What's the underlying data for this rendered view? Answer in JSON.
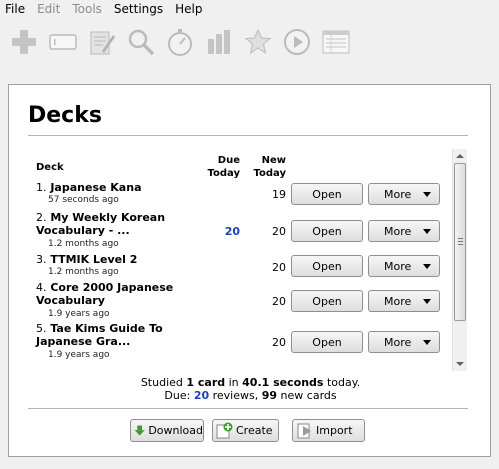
{
  "menu": {
    "file": "File",
    "edit": "Edit",
    "tools": "Tools",
    "settings": "Settings",
    "help": "Help"
  },
  "toolbar": {
    "icons": [
      "add-icon",
      "card-icon",
      "edit-icon",
      "search-icon",
      "stopwatch-icon",
      "stats-icon",
      "star-icon",
      "play-icon",
      "list-icon"
    ]
  },
  "main": {
    "title": "Decks",
    "headers": {
      "deck": "Deck",
      "due_line1": "Due",
      "due_line2": "Today",
      "new_line1": "New",
      "new_line2": "Today"
    },
    "decks": [
      {
        "num": "1.",
        "name_line1": "Japanese Kana",
        "name_line2": "",
        "ago": "57 seconds ago",
        "due": "",
        "new": "19"
      },
      {
        "num": "2.",
        "name_line1": "My Weekly Korean",
        "name_line2": "Vocabulary - ...",
        "ago": "1.2 months ago",
        "due": "20",
        "new": "20"
      },
      {
        "num": "3.",
        "name_line1": "TTMIK Level 2",
        "name_line2": "",
        "ago": "1.2 months ago",
        "due": "",
        "new": "20"
      },
      {
        "num": "4.",
        "name_line1": "Core 2000 Japanese",
        "name_line2": "Vocabulary",
        "ago": "1.9 years ago",
        "due": "",
        "new": "20"
      },
      {
        "num": "5.",
        "name_line1": "Tae Kims Guide To",
        "name_line2": "Japanese Gra...",
        "ago": "1.9 years ago",
        "due": "",
        "new": "20"
      }
    ],
    "open_label": "Open",
    "more_label": "More",
    "summary": {
      "studied_prefix": "Studied ",
      "studied_count": "1 card",
      "studied_mid": " in ",
      "studied_time": "40.1 seconds",
      "studied_suffix": " today.",
      "due_prefix": "Due: ",
      "due_reviews": "20",
      "due_mid": " reviews, ",
      "due_new": "99",
      "due_suffix": " new cards"
    }
  },
  "bottom": {
    "download": "Download",
    "create": "Create",
    "import": "Import"
  },
  "colors": {
    "due_blue": "#1b3fbf",
    "panel_bg": "#ffffff",
    "window_bg": "#f0f0f0"
  }
}
